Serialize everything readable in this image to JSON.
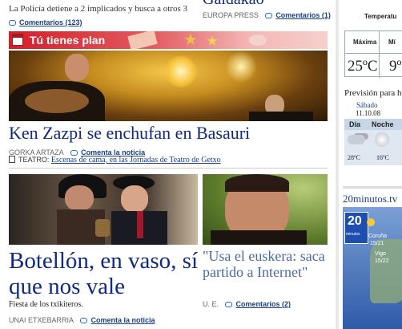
{
  "top": {
    "left_line": "La Policía detiene a 2 implicados y busca a otros 3",
    "left_comments": "Comentarios (123)",
    "right_title_fragment": "Galdakao",
    "right_source": "EUROPA PRESS",
    "right_comments": "Comentarios (1)"
  },
  "plan_banner": {
    "label": "Tú tienes plan"
  },
  "feature": {
    "headline": "Ken Zazpi se enchufan en Basauri",
    "author": "GORKA ARTAZA",
    "comment_link": "Comenta la noticia",
    "theatre_label": "TEATRO:",
    "theatre_link": "Escenas de cama, en las Jornadas de Teatro de Getxo"
  },
  "botellon": {
    "headline": "Botellón, en vaso, sí que nos vale",
    "subtitle": "Fiesta de los txikiteros.",
    "author": "UNAI ETXEBARRIA",
    "comment_link": "Comenta la noticia"
  },
  "euskera": {
    "headline": "\"Usa el euskera: saca partido a Internet\"",
    "author": "U. E.",
    "comments": "Comentarios (2)"
  },
  "weather": {
    "temperature_label": "Temperatu",
    "max_label": "Máxima",
    "min_label": "Mí",
    "max_value": "25ºC",
    "min_value": "9º",
    "forecast_label": "Previsión para h",
    "day": "Sábado",
    "date": "11.10.08",
    "col_day": "Día",
    "col_night": "Noche",
    "day_temp": "28ºC",
    "night_temp": "16ºC"
  },
  "sidebar_promo": {
    "site": "20minutos.tv",
    "logo_text": "20",
    "logo_sub": "minutos",
    "city1": "Coruña",
    "city1_temp": "15/21",
    "city2": "Vigo",
    "city2_temp": "15/22"
  },
  "colors": {
    "accent_red": "#d8262f",
    "link_blue": "#1a3f8c",
    "headline_blue": "#0f2a80"
  }
}
